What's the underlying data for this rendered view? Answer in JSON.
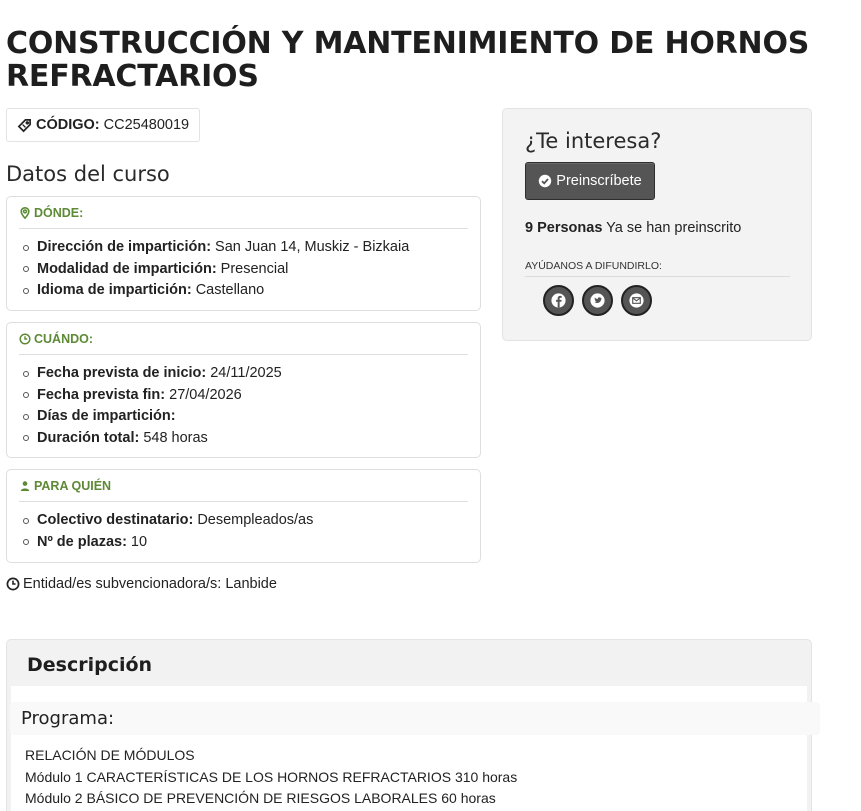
{
  "course": {
    "title": "CONSTRUCCIÓN Y MANTENIMIENTO DE HORNOS REFRACTARIOS",
    "code_label": "CÓDIGO:",
    "code_value": "CC25480019"
  },
  "details": {
    "section_title": "Datos del curso",
    "where": {
      "heading": "DÓNDE:",
      "items": [
        {
          "label": "Dirección de impartición:",
          "value": "San Juan 14, Muskiz - Bizkaia"
        },
        {
          "label": "Modalidad de impartición:",
          "value": "Presencial"
        },
        {
          "label": "Idioma de impartición:",
          "value": "Castellano"
        }
      ]
    },
    "when": {
      "heading": "CUÁNDO:",
      "items": [
        {
          "label": "Fecha prevista de inicio:",
          "value": "24/11/2025"
        },
        {
          "label": "Fecha prevista fin:",
          "value": "27/04/2026"
        },
        {
          "label": "Días de impartición:",
          "value": ""
        },
        {
          "label": "Duración total:",
          "value": "548 horas"
        }
      ]
    },
    "who": {
      "heading": "PARA QUIÉN",
      "items": [
        {
          "label": "Colectivo destinatario:",
          "value": "Desempleados/as"
        },
        {
          "label": "Nº de plazas:",
          "value": "10"
        }
      ]
    },
    "entity": "Entidad/es subvencionadora/s: Lanbide"
  },
  "sidebar": {
    "question": "¿Te interesa?",
    "button_label": "Preinscríbete",
    "count_number": "9 Personas",
    "count_text": "Ya se han preinscrito",
    "share_heading": "AYÚDANOS A DIFUNDIRLO:",
    "share_icons": [
      "facebook-icon",
      "twitter-icon",
      "email-icon"
    ]
  },
  "description": {
    "heading": "Descripción",
    "program_label": "Programa:",
    "lines": [
      "RELACIÓN DE MÓDULOS",
      "Módulo 1 CARACTERÍSTICAS DE LOS HORNOS REFRACTARIOS 310 horas",
      "Módulo 2 BÁSICO DE PREVENCIÓN DE RIESGOS LABORALES 60 horas"
    ]
  },
  "colors": {
    "accent_green": "#5d8a35",
    "button_bg": "#555555",
    "panel_bg": "#f3f3f3"
  }
}
